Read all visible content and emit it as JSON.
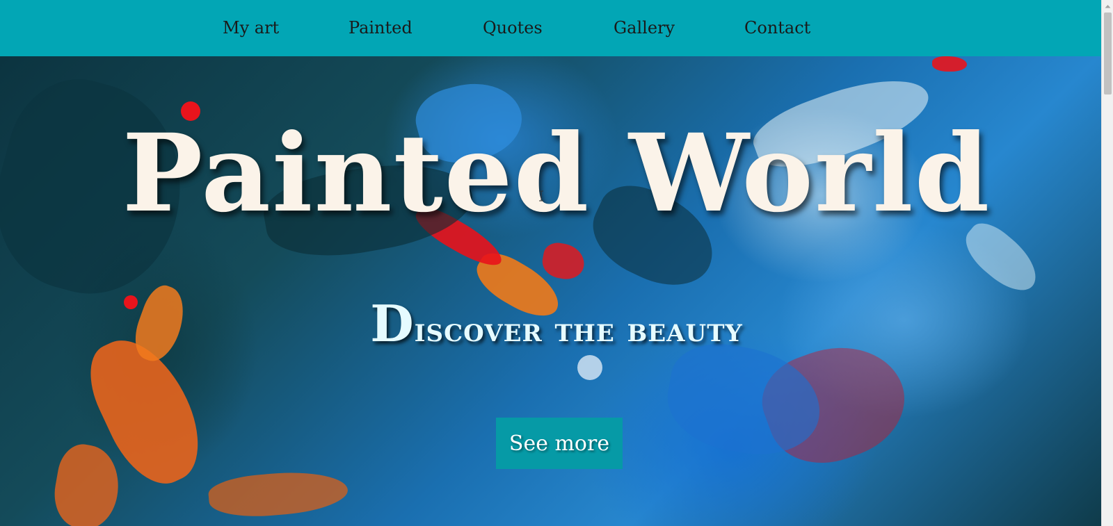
{
  "nav": {
    "links": [
      {
        "label": "My art"
      },
      {
        "label": "Painted"
      },
      {
        "label": "Quotes"
      },
      {
        "label": "Gallery"
      },
      {
        "label": "Contact"
      }
    ]
  },
  "hero": {
    "title": "Painted World",
    "subtitle_first": "D",
    "subtitle_rest": "iscover the beauty",
    "button_label": "See more",
    "background_image": "abstract-paint-texture"
  },
  "colors": {
    "nav_background": "#02a6b5",
    "button_background": "#069aa6",
    "title_color": "#fbf3e9",
    "subtitle_color": "#e6fbff"
  },
  "cursor": "text-cursor-icon",
  "scrollbar": {
    "arrow_icon": "scroll-up-arrow-icon"
  }
}
